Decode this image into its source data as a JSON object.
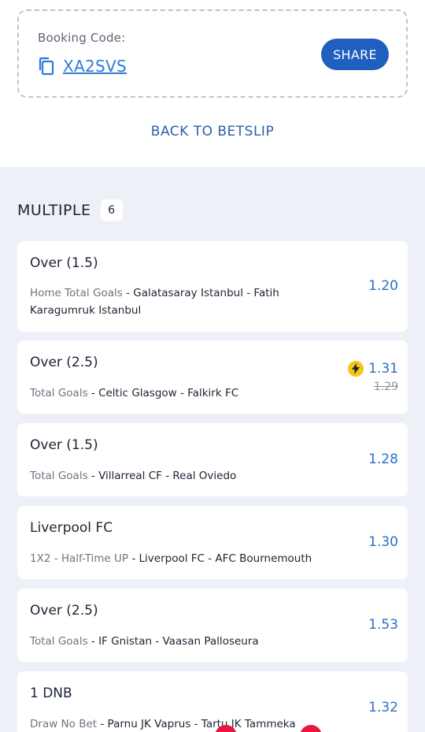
{
  "booking": {
    "label": "Booking Code:",
    "code": "XA2SVS",
    "share_label": "SHARE",
    "back_label": "BACK TO BETSLIP"
  },
  "section": {
    "title": "MULTIPLE",
    "count": "6"
  },
  "colors": {
    "accent": "#1f5fbf",
    "odds": "#2b6fc6",
    "boost": "#f4c518",
    "background": "#eef0f8"
  },
  "selections": [
    {
      "pick": "Over (1.5)",
      "market": "Home Total Goals",
      "event": "Galatasaray Istanbul - Fatih Karagumruk Istanbul",
      "odds": "1.20"
    },
    {
      "pick": "Over (2.5)",
      "market": "Total Goals",
      "event": "Celtic Glasgow - Falkirk FC",
      "odds": "1.31",
      "old_odds": "1.29",
      "boost_icon": "lightning-icon"
    },
    {
      "pick": "Over (1.5)",
      "market": "Total Goals",
      "event": "Villarreal CF - Real Oviedo",
      "odds": "1.28"
    },
    {
      "pick": "Liverpool FC",
      "market": "1X2 - Half-Time UP",
      "event": "Liverpool FC - AFC Bournemouth",
      "odds": "1.30"
    },
    {
      "pick": "Over (2.5)",
      "market": "Total Goals",
      "event": "IF Gnistan - Vaasan Palloseura",
      "odds": "1.53"
    },
    {
      "pick": "1 DNB",
      "market": "Draw No Bet",
      "event": "Parnu JK Vaprus - Tartu JK Tammeka",
      "odds": "1.32"
    }
  ]
}
